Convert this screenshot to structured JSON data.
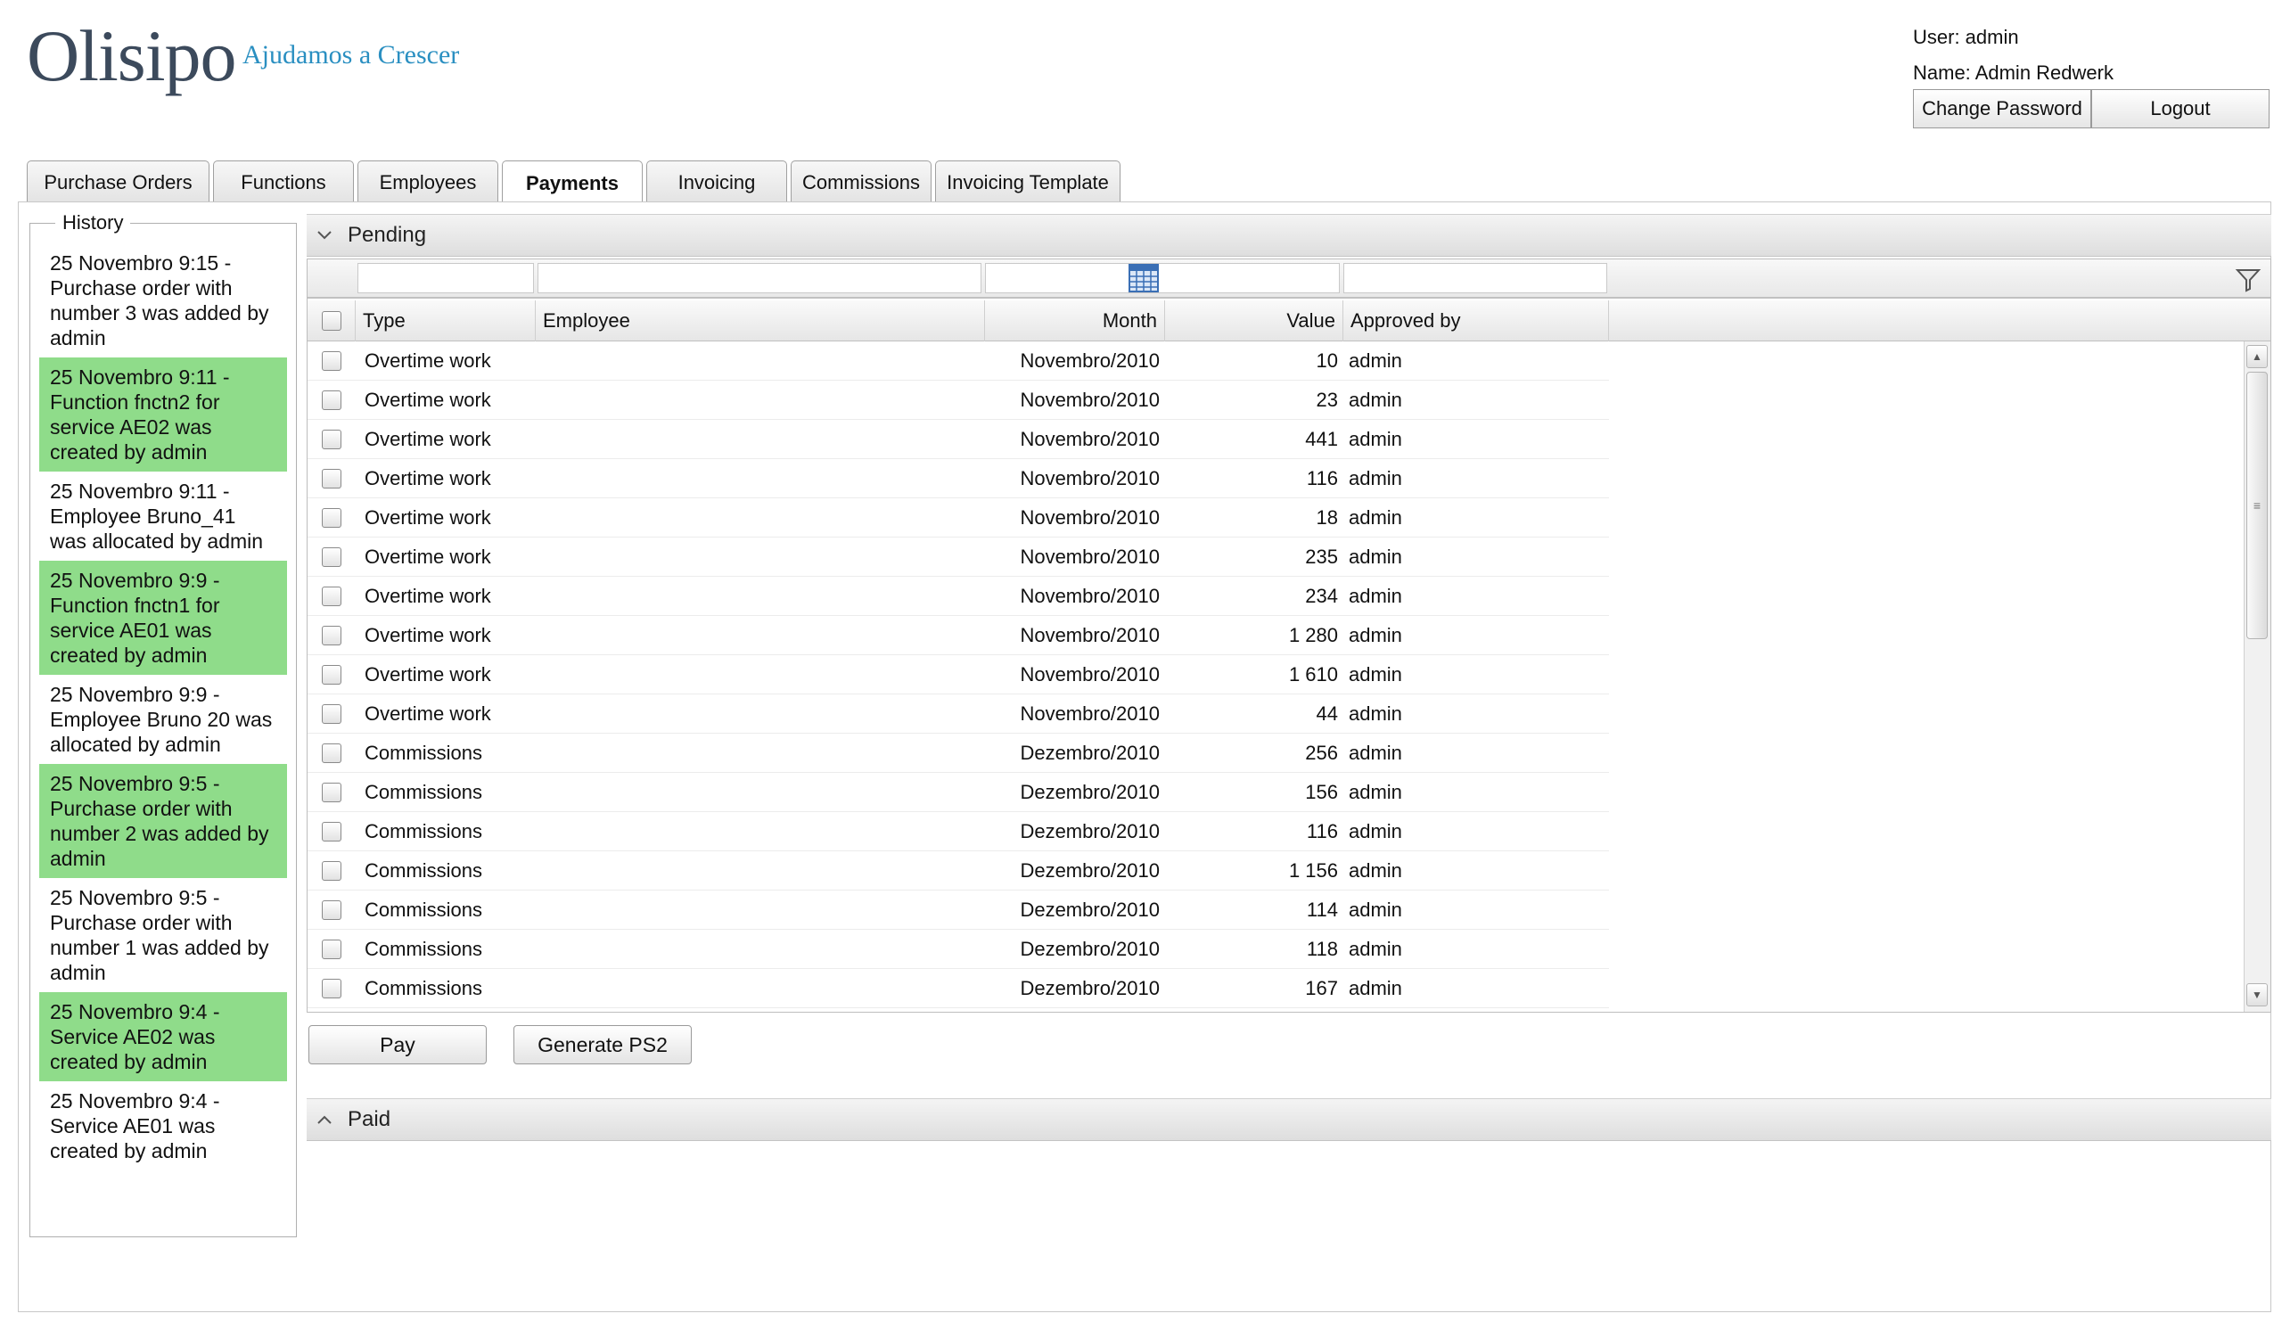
{
  "header": {
    "logo_text": "Olisipo",
    "tagline": "Ajudamos a Crescer",
    "user_line": "User: admin",
    "name_line": "Name: Admin Redwerk",
    "change_password_label": "Change Password",
    "logout_label": "Logout"
  },
  "tabs": [
    {
      "label": "Purchase Orders",
      "active": false
    },
    {
      "label": "Functions",
      "active": false
    },
    {
      "label": "Employees",
      "active": false
    },
    {
      "label": "Payments",
      "active": true
    },
    {
      "label": "Invoicing",
      "active": false
    },
    {
      "label": "Commissions",
      "active": false
    },
    {
      "label": "Invoicing Template",
      "active": false
    }
  ],
  "history": {
    "title": "History",
    "items": [
      {
        "text": "25 Novembro 9:15 - Purchase order with number 3 was added by admin",
        "highlight": false
      },
      {
        "text": "25 Novembro 9:11 - Function fnctn2 for service AE02 was created by admin",
        "highlight": true
      },
      {
        "text": "25 Novembro 9:11 - Employee Bruno_41 was allocated by admin",
        "highlight": false
      },
      {
        "text": "25 Novembro 9:9 - Function fnctn1 for service AE01 was created by admin",
        "highlight": true
      },
      {
        "text": "25 Novembro 9:9 - Employee Bruno 20 was allocated by admin",
        "highlight": false
      },
      {
        "text": "25 Novembro 9:5 - Purchase order with number 2 was added by admin",
        "highlight": true
      },
      {
        "text": "25 Novembro 9:5 - Purchase order with number 1 was added by admin",
        "highlight": false
      },
      {
        "text": "25 Novembro 9:4 - Service AE02 was created by admin",
        "highlight": true
      },
      {
        "text": "25 Novembro 9:4 - Service AE01 was created by admin",
        "highlight": false
      }
    ],
    "highlight_color": "#8fdc8a"
  },
  "pending": {
    "title": "Pending",
    "columns": {
      "type": "Type",
      "employee": "Employee",
      "month": "Month",
      "value": "Value",
      "approved_by": "Approved by"
    },
    "rows": [
      {
        "type": "Overtime work",
        "employee": "",
        "month": "Novembro/2010",
        "value": "10",
        "approved_by": "admin"
      },
      {
        "type": "Overtime work",
        "employee": "",
        "month": "Novembro/2010",
        "value": "23",
        "approved_by": "admin"
      },
      {
        "type": "Overtime work",
        "employee": "",
        "month": "Novembro/2010",
        "value": "441",
        "approved_by": "admin"
      },
      {
        "type": "Overtime work",
        "employee": "",
        "month": "Novembro/2010",
        "value": "116",
        "approved_by": "admin"
      },
      {
        "type": "Overtime work",
        "employee": "",
        "month": "Novembro/2010",
        "value": "18",
        "approved_by": "admin"
      },
      {
        "type": "Overtime work",
        "employee": "",
        "month": "Novembro/2010",
        "value": "235",
        "approved_by": "admin"
      },
      {
        "type": "Overtime work",
        "employee": "",
        "month": "Novembro/2010",
        "value": "234",
        "approved_by": "admin"
      },
      {
        "type": "Overtime work",
        "employee": "",
        "month": "Novembro/2010",
        "value": "1 280",
        "approved_by": "admin"
      },
      {
        "type": "Overtime work",
        "employee": "",
        "month": "Novembro/2010",
        "value": "1 610",
        "approved_by": "admin"
      },
      {
        "type": "Overtime work",
        "employee": "",
        "month": "Novembro/2010",
        "value": "44",
        "approved_by": "admin"
      },
      {
        "type": "Commissions",
        "employee": "",
        "month": "Dezembro/2010",
        "value": "256",
        "approved_by": "admin"
      },
      {
        "type": "Commissions",
        "employee": "",
        "month": "Dezembro/2010",
        "value": "156",
        "approved_by": "admin"
      },
      {
        "type": "Commissions",
        "employee": "",
        "month": "Dezembro/2010",
        "value": "116",
        "approved_by": "admin"
      },
      {
        "type": "Commissions",
        "employee": "",
        "month": "Dezembro/2010",
        "value": "1 156",
        "approved_by": "admin"
      },
      {
        "type": "Commissions",
        "employee": "",
        "month": "Dezembro/2010",
        "value": "114",
        "approved_by": "admin"
      },
      {
        "type": "Commissions",
        "employee": "",
        "month": "Dezembro/2010",
        "value": "118",
        "approved_by": "admin"
      },
      {
        "type": "Commissions",
        "employee": "",
        "month": "Dezembro/2010",
        "value": "167",
        "approved_by": "admin"
      }
    ],
    "pay_label": "Pay",
    "generate_label": "Generate PS2",
    "icons": {
      "collapse": "chevron-down-icon",
      "calendar": "calendar-icon",
      "filter": "filter-icon"
    }
  },
  "paid": {
    "title": "Paid",
    "icon": "chevron-up-icon"
  }
}
